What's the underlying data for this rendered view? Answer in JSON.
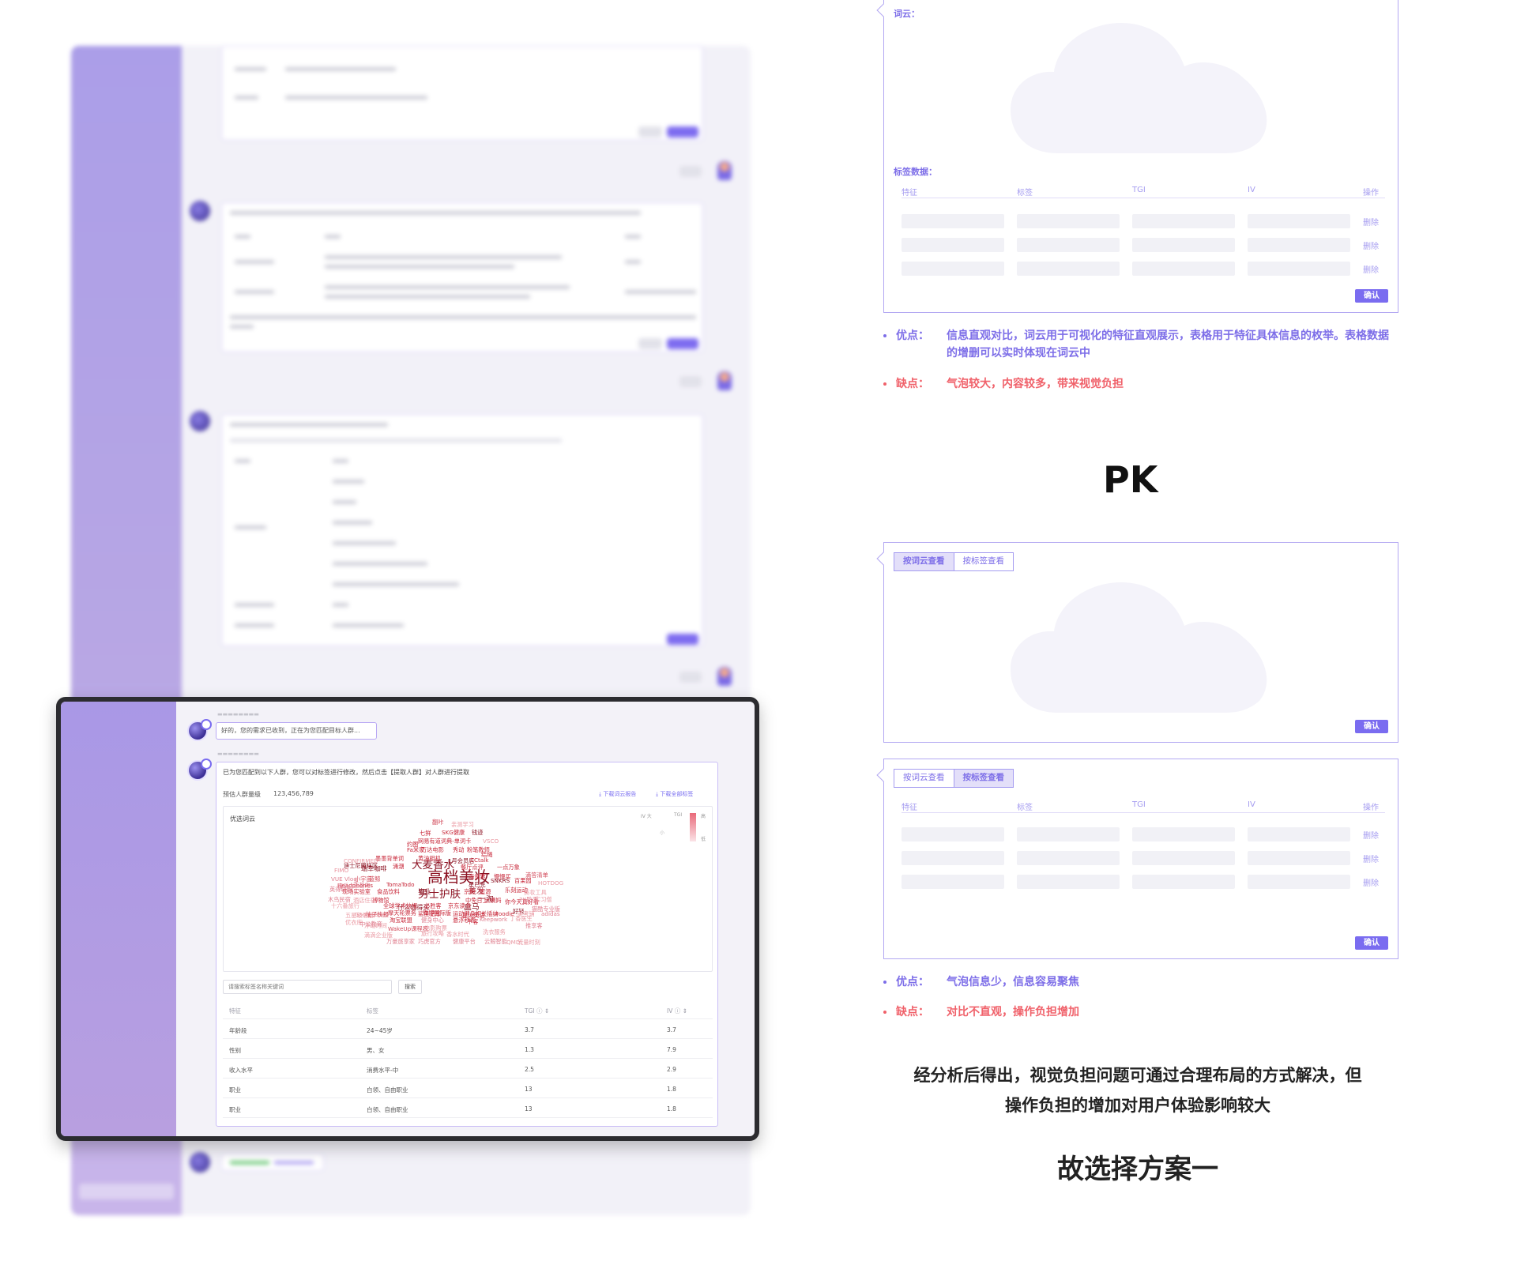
{
  "focus": {
    "msg1": "好的，您的需求已收到，正在为您匹配目标人群...",
    "msg2_intro": "已为您匹配到以下人群，您可以对标签进行修改，然后点击【提取人群】对人群进行提取",
    "count_label": "预估人群量级",
    "count_value": "123,456,789",
    "download_report": "下载词云报告",
    "download_tags": "下载全部标签",
    "wordcloud_title": "优选词云",
    "legend": {
      "iv": "IV",
      "big": "大",
      "tgi": "TGI",
      "high": "高",
      "low": "低",
      "small": "小"
    },
    "search_placeholder": "请搜索标签名称关键词",
    "search_button": "搜索",
    "table_headers": [
      "特征",
      "标签",
      "TGI ⓘ ⇕",
      "IV ⓘ ⇕"
    ],
    "table_rows": [
      [
        "年龄段",
        "24~45岁",
        "3.7",
        "3.7"
      ],
      [
        "性别",
        "男、女",
        "1.3",
        "7.9"
      ],
      [
        "收入水平",
        "消费水平-中",
        "2.5",
        "2.9"
      ],
      [
        "职业",
        "白领、自由职业",
        "13",
        "1.8"
      ],
      [
        "职业",
        "白领、自由职业",
        "13",
        "1.8"
      ]
    ],
    "words": [
      {
        "t": "高档美妆",
        "c": "#8b1020",
        "s": 22
      },
      {
        "t": "大麦香水",
        "c": "#8b1020",
        "s": 15
      },
      {
        "t": "男士护肤",
        "c": "#8b1020",
        "s": 15
      },
      {
        "t": "美发",
        "c": "#a0182a",
        "s": 11
      },
      {
        "t": "盒马",
        "c": "#8b1020",
        "s": 11
      },
      {
        "t": "一淘",
        "c": "#8b1020",
        "s": 11
      },
      {
        "t": "什么值得买",
        "c": "#8b1020",
        "s": 9
      },
      {
        "t": "瑞幸咖啡",
        "c": "#8b1020",
        "s": 9
      },
      {
        "t": "迪士尼魔样区",
        "c": "#8b1020",
        "s": 8
      },
      {
        "t": "Headphones",
        "c": "#c8283a",
        "s": 8
      },
      {
        "t": "TomaTodo",
        "c": "#c8283a",
        "s": 8
      },
      {
        "t": "现场实验室",
        "c": "#c8283a",
        "s": 8
      },
      {
        "t": "食品饮料",
        "c": "#c8283a",
        "s": 8
      },
      {
        "t": "毕业",
        "c": "#8b1020",
        "s": 9
      },
      {
        "t": "涌潮",
        "c": "#c8283a",
        "s": 8
      },
      {
        "t": "墨墨背单词",
        "c": "#c8283a",
        "s": 8
      },
      {
        "t": "黄油相机",
        "c": "#c8283a",
        "s": 8
      },
      {
        "t": "1号会员店",
        "c": "#8b1020",
        "s": 8
      },
      {
        "t": "CCtalk",
        "c": "#c8283a",
        "s": 8
      },
      {
        "t": "餐厅点评",
        "c": "#c8283a",
        "s": 8
      },
      {
        "t": "一点万象",
        "c": "#c8283a",
        "s": 8
      },
      {
        "t": "海贵票",
        "c": "#c8283a",
        "s": 8
      },
      {
        "t": "慢慢买",
        "c": "#c8283a",
        "s": 8
      },
      {
        "t": "星巴克",
        "c": "#8b1020",
        "s": 8
      },
      {
        "t": "SNKRS",
        "c": "#8b1020",
        "s": 8
      },
      {
        "t": "百果园",
        "c": "#c8283a",
        "s": 8
      },
      {
        "t": "京粉",
        "c": "#c8283a",
        "s": 8
      },
      {
        "t": "蜜源",
        "c": "#c8283a",
        "s": 8
      },
      {
        "t": "乐刻运动",
        "c": "#c8283a",
        "s": 8
      },
      {
        "t": "中免日上",
        "c": "#c8283a",
        "s": 8
      },
      {
        "t": "大姨妈",
        "c": "#c8283a",
        "s": 8
      },
      {
        "t": "你今天真好看",
        "c": "#c8283a",
        "s": 8
      },
      {
        "t": "鲨鱼记账",
        "c": "#c8283a",
        "s": 8
      },
      {
        "t": "必胜客",
        "c": "#c8283a",
        "s": 8
      },
      {
        "t": "京东读书",
        "c": "#c8283a",
        "s": 8
      },
      {
        "t": "星火英语",
        "c": "#c8283a",
        "s": 8
      },
      {
        "t": "Foodie",
        "c": "#c8283a",
        "s": 8
      },
      {
        "t": "好轻",
        "c": "#8b1020",
        "s": 8
      },
      {
        "t": "全球学术快报",
        "c": "#c8283a",
        "s": 8
      },
      {
        "t": "摩天轮票务",
        "c": "#c8283a",
        "s": 8
      },
      {
        "t": "微博国际版",
        "c": "#c8283a",
        "s": 8
      },
      {
        "t": "运动健身相关插纳",
        "c": "#c8283a",
        "s": 8
      },
      {
        "t": "柚子快报",
        "c": "#c8283a",
        "s": 8
      },
      {
        "t": "淘宝联盟",
        "c": "#c8283a",
        "s": 8
      },
      {
        "t": "博物馆",
        "c": "#c8283a",
        "s": 8
      },
      {
        "t": "WakeUp课程表",
        "c": "#d24a5a",
        "s": 8
      },
      {
        "t": "健身中心",
        "c": "#e08090",
        "s": 8
      },
      {
        "t": "悬浮秒表",
        "c": "#c8283a",
        "s": 8
      },
      {
        "t": "牛客",
        "c": "#c8283a",
        "s": 8
      },
      {
        "t": "Keepwork",
        "c": "#e08090",
        "s": 8
      },
      {
        "t": "小宇宙",
        "c": "#d24a5a",
        "s": 8
      },
      {
        "t": "蓝鲸",
        "c": "#d24a5a",
        "s": 8
      },
      {
        "t": "FIMO",
        "c": "#e9909c",
        "s": 8
      },
      {
        "t": "CONFIRMED",
        "c": "#ea98a2",
        "s": 8
      },
      {
        "t": "网易有道词典-单词卡",
        "c": "#c8283a",
        "s": 8
      },
      {
        "t": "万达电影",
        "c": "#c8283a",
        "s": 8
      },
      {
        "t": "秀动",
        "c": "#c8283a",
        "s": 8
      },
      {
        "t": "粉笔教师",
        "c": "#c8283a",
        "s": 8
      },
      {
        "t": "结绳",
        "c": "#c8283a",
        "s": 8
      },
      {
        "t": "Fa米家",
        "c": "#c8283a",
        "s": 8
      },
      {
        "t": "约图",
        "c": "#c8283a",
        "s": 8
      },
      {
        "t": "SKG健康",
        "c": "#c8283a",
        "s": 8
      },
      {
        "t": "钱迹",
        "c": "#8b1020",
        "s": 8
      },
      {
        "t": "七鲜",
        "c": "#c8283a",
        "s": 8
      },
      {
        "t": "翻咔",
        "c": "#d24a5a",
        "s": 8
      },
      {
        "t": "亲测学习",
        "c": "#ea98a2",
        "s": 8
      },
      {
        "t": "VSCO",
        "c": "#ea98a2",
        "s": 8
      },
      {
        "t": "滴答清单",
        "c": "#d24a5a",
        "s": 8
      },
      {
        "t": "HOTDOG",
        "c": "#ea98a2",
        "s": 8
      },
      {
        "t": "美妆工具",
        "c": "#ea98a2",
        "s": 8
      },
      {
        "t": "2K助手",
        "c": "#e08090",
        "s": 8
      },
      {
        "t": "实习僧",
        "c": "#ea98a2",
        "s": 8
      },
      {
        "t": "猫酷专业版",
        "c": "#e08090",
        "s": 8
      },
      {
        "t": "adidas",
        "c": "#e08090",
        "s": 8
      },
      {
        "t": "美考铺",
        "c": "#ea98a2",
        "s": 8
      },
      {
        "t": "丁香医生",
        "c": "#ea98a2",
        "s": 8
      },
      {
        "t": "电影购票",
        "c": "#ea98a2",
        "s": 8
      },
      {
        "t": "香水时代",
        "c": "#ea98a2",
        "s": 8
      },
      {
        "t": "洗衣服务",
        "c": "#ea98a2",
        "s": 8
      },
      {
        "t": "推享客",
        "c": "#e08090",
        "s": 8
      },
      {
        "t": "旅行攻略",
        "c": "#ea98a2",
        "s": 8
      },
      {
        "t": "巧虎官方",
        "c": "#e08090",
        "s": 8
      },
      {
        "t": "健康平台",
        "c": "#e08090",
        "s": 8
      },
      {
        "t": "云鲸智能",
        "c": "#e08090",
        "s": 8
      },
      {
        "t": "万豪旅享家",
        "c": "#e08090",
        "s": 8
      },
      {
        "t": "滴滴企业版",
        "c": "#ea98a2",
        "s": 8
      },
      {
        "t": "浮动时间",
        "c": "#ea98a2",
        "s": 8
      },
      {
        "t": "五星级酒店",
        "c": "#ea98a2",
        "s": 8
      },
      {
        "t": "优衣库",
        "c": "#ea98a2",
        "s": 8
      },
      {
        "t": "Good Lock",
        "c": "#ea98a2",
        "s": 8
      },
      {
        "t": "酒店住宿",
        "c": "#ea98a2",
        "s": 8
      },
      {
        "t": "十六番旅行",
        "c": "#ea98a2",
        "s": 8
      },
      {
        "t": "木鸟民宿",
        "c": "#e08090",
        "s": 8
      },
      {
        "t": "英得联盟",
        "c": "#e08090",
        "s": 8
      },
      {
        "t": "VUE Vlog",
        "c": "#e08090",
        "s": 8
      },
      {
        "t": "音乐",
        "c": "#e08090",
        "s": 8
      },
      {
        "t": "蓝基的",
        "c": "#e08090",
        "s": 8
      },
      {
        "t": "中公教育",
        "c": "#e08090",
        "s": 8
      },
      {
        "t": "QMD",
        "c": "#ea98a2",
        "s": 8
      },
      {
        "t": "流量时刻",
        "c": "#ea98a2",
        "s": 8
      }
    ]
  },
  "panel1": {
    "cloud_label": "词云：",
    "table_label": "标签数据：",
    "headers": [
      "特征",
      "标签",
      "TGI",
      "IV",
      "操作"
    ],
    "delete": "删除",
    "confirm": "确认"
  },
  "notes1": {
    "pro_label": "优点：",
    "pro_text": "信息直观对比，词云用于可视化的特征直观展示，表格用于特征具体信息的枚举。表格数据的增删可以实时体现在词云中",
    "con_label": "缺点：",
    "con_text": "气泡较大，内容较多，带来视觉负担"
  },
  "pk": "PK",
  "panel2": {
    "tab_cloud": "按词云查看",
    "tab_tags": "按标签查看",
    "confirm": "确认"
  },
  "panel3": {
    "tab_cloud": "按词云查看",
    "tab_tags": "按标签查看",
    "headers": [
      "特征",
      "标签",
      "TGI",
      "IV",
      "操作"
    ],
    "delete": "删除",
    "confirm": "确认"
  },
  "notes2": {
    "pro_label": "优点：",
    "pro_text": "气泡信息少，信息容易聚焦",
    "con_label": "缺点：",
    "con_text": "对比不直观，操作负担增加"
  },
  "conclusion_line1": "经分析后得出，视觉负担问题可通过合理布局的方式解决，但",
  "conclusion_line2": "操作负担的增加对用户体验影响较大",
  "choice": "故选择方案一",
  "colors": {
    "accent": "#7a6cf0",
    "con": "#f0616a",
    "cloud": "#f4f3fa"
  }
}
